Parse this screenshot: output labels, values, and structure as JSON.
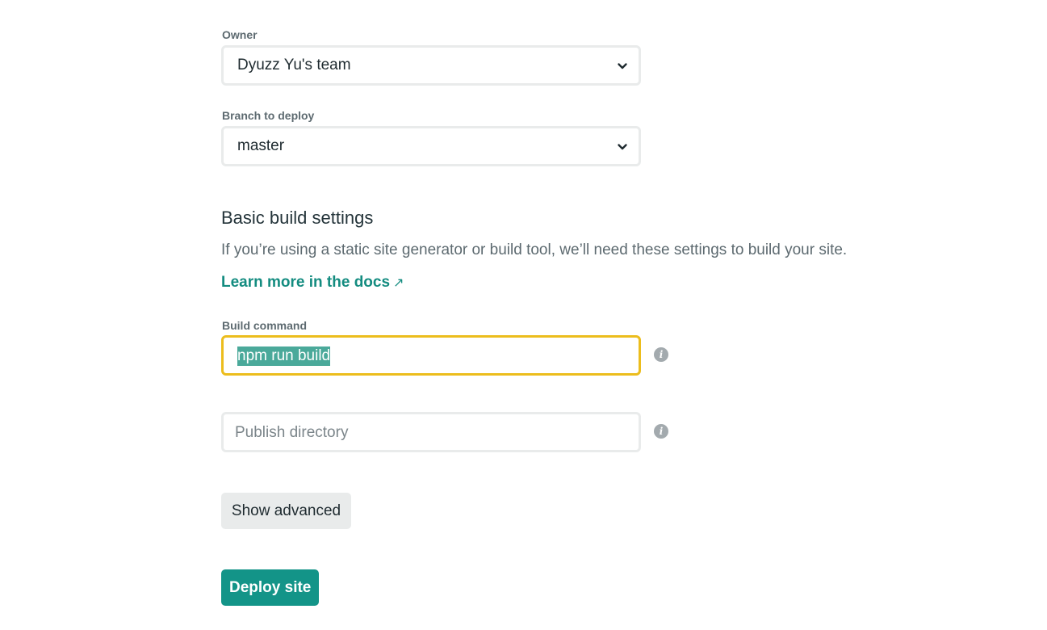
{
  "owner": {
    "label": "Owner",
    "selected": "Dyuzz Yu's team"
  },
  "branch": {
    "label": "Branch to deploy",
    "selected": "master"
  },
  "build_settings": {
    "title": "Basic build settings",
    "description": "If you’re using a static site generator or build tool, we’ll need these settings to build your site.",
    "docs_link": "Learn more in the docs",
    "docs_link_arrow": "↗"
  },
  "build_command": {
    "label": "Build command",
    "value": "npm run build",
    "info_glyph": "i"
  },
  "publish_directory": {
    "placeholder": "Publish directory",
    "info_glyph": "i"
  },
  "buttons": {
    "show_advanced": "Show advanced",
    "deploy": "Deploy site"
  },
  "colors": {
    "accent": "#139488",
    "link": "#148c80",
    "focus_border": "#ecbd1d",
    "selection": "#4aa99a"
  },
  "icons": {
    "select_chevron": "chevron-down-icon",
    "info": "info-icon",
    "external_link": "external-link-icon"
  }
}
